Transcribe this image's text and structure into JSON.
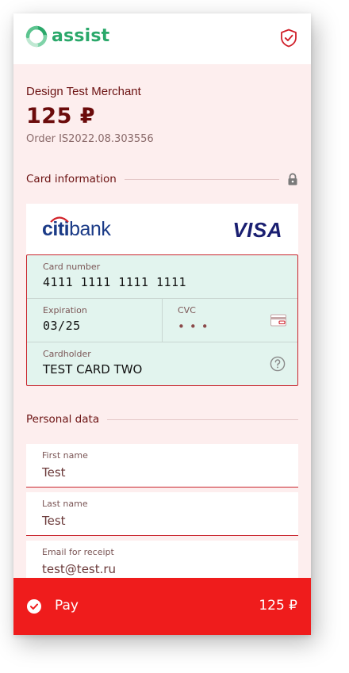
{
  "app": {
    "logo_text": "assist"
  },
  "merchant": {
    "name": "Design Test Merchant",
    "amount": "125 ₽",
    "order": "Order IS2022.08.303556"
  },
  "card_section": {
    "title": "Card information",
    "bank_name_bold": "citi",
    "bank_name_rest": "bank",
    "network": "VISA",
    "card_number": {
      "label": "Card number",
      "value": "4111 1111 1111 1111"
    },
    "expiration": {
      "label": "Expiration",
      "value": "03/25"
    },
    "cvc": {
      "label": "CVC",
      "value": "•••"
    },
    "cardholder": {
      "label": "Cardholder",
      "value": "TEST CARD TWO"
    }
  },
  "personal_section": {
    "title": "Personal data",
    "first_name": {
      "label": "First name",
      "value": "Test"
    },
    "last_name": {
      "label": "Last name",
      "value": "Test"
    },
    "email": {
      "label": "Email for receipt",
      "value": "test@test.ru"
    }
  },
  "pay": {
    "label": "Pay",
    "amount": "125 ₽"
  },
  "colors": {
    "brand_green": "#2aa86a",
    "accent_red": "#ef1c1c",
    "panel_bg": "#fdeeee",
    "card_fields_bg": "#e2f4ee",
    "merchant_text": "#6b0b0b"
  },
  "icons": {
    "logo": "assist-logo-icon",
    "shield": "shield-check-icon",
    "lock": "lock-icon",
    "cvc": "card-cvc-icon",
    "help": "question-circle-icon",
    "pay": "check-circle-icon"
  }
}
